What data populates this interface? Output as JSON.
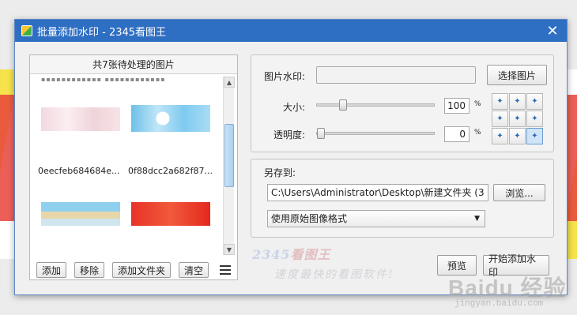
{
  "window": {
    "title": "批量添加水印 - 2345看图王",
    "close_glyph": "✕"
  },
  "file_panel": {
    "header": "共7张待处理的图片",
    "files": [
      {
        "name": "0eecfeb684684e..."
      },
      {
        "name": "0f88dcc2a682f87..."
      }
    ],
    "buttons": {
      "add": "添加",
      "remove": "移除",
      "add_folder": "添加文件夹",
      "clear": "清空"
    },
    "scroll_up": "▲",
    "scroll_down": "▼"
  },
  "watermark": {
    "image_label": "图片水印:",
    "image_value": "",
    "choose_button": "选择图片",
    "size_label": "大小:",
    "size_value": "100",
    "size_fraction": 0.2,
    "opacity_label": "透明度:",
    "opacity_value": "0",
    "opacity_fraction": 0.0,
    "percent": "%",
    "position_selected": 8
  },
  "save": {
    "label": "另存到:",
    "path": "C:\\Users\\Administrator\\Desktop\\新建文件夹 (3",
    "browse_button": "浏览...",
    "format": "使用原始图像格式",
    "select_arrow": "▼"
  },
  "brand": {
    "logo_num": "2345",
    "logo_cn": "看图王",
    "slogan": "速度最快的看图软件!"
  },
  "actions": {
    "preview": "预览",
    "start": "开始添加水印"
  },
  "site_watermark": {
    "text": "Baidu 经验",
    "url": "jingyan.baidu.com"
  },
  "colors": {
    "titlebar": "#2f6fc3",
    "accent": "#2a6ab3"
  }
}
